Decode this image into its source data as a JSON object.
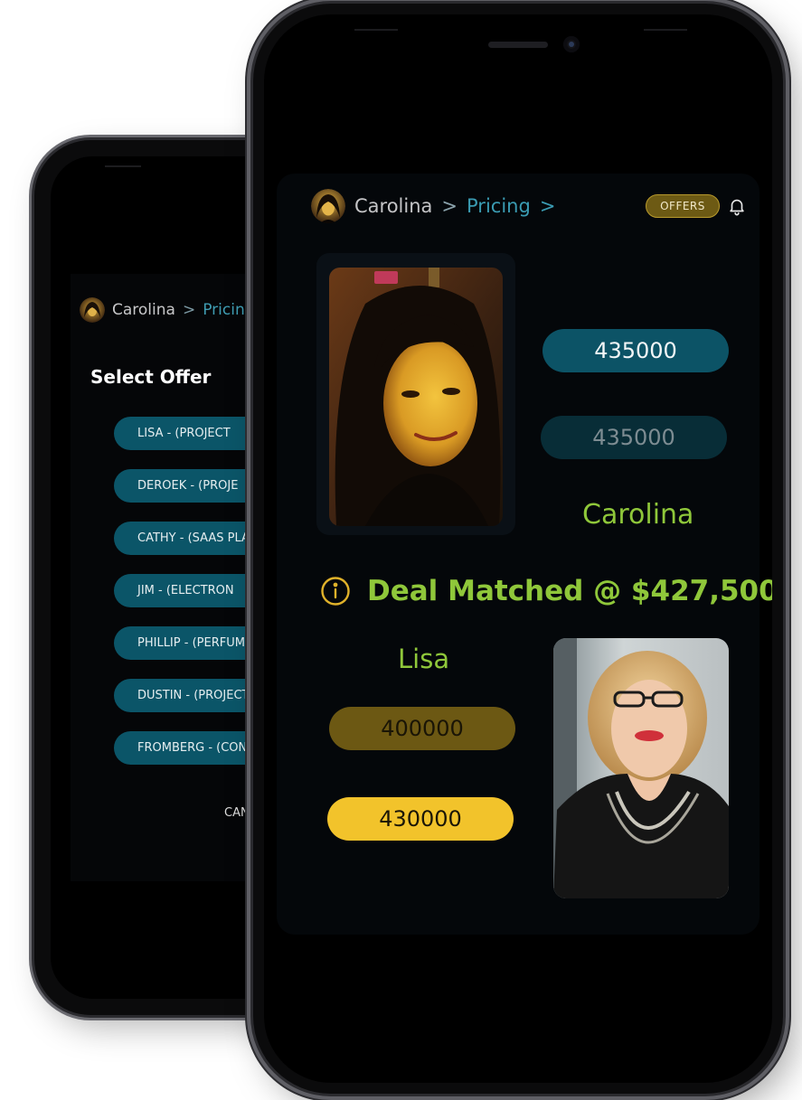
{
  "back_screen": {
    "breadcrumb": {
      "user": "Carolina",
      "page": "Pricing"
    },
    "title": "Select Offer",
    "offers": [
      "LISA - (PROJECT",
      "DEROEK - (PROJE",
      "CATHY - (SAAS PLAT",
      "JIM - (ELECTRON",
      "PHILLIP - (PERFUM",
      "DUSTIN - (PROJECT",
      "FROMBERG - (CON"
    ],
    "cancel_label": "CAN"
  },
  "front_screen": {
    "breadcrumb": {
      "user": "Carolina",
      "separator": ">",
      "page": "Pricing",
      "trailing": ">"
    },
    "offers_button": "OFFERS",
    "icons": {
      "bell": "bell-icon",
      "info": "info-icon"
    },
    "seller": {
      "name": "Carolina",
      "ask_primary": "435000",
      "ask_secondary": "435000"
    },
    "deal_text": "Deal Matched @ $427,500",
    "buyer": {
      "name": "Lisa",
      "bid_previous": "400000",
      "bid_current": "430000"
    }
  },
  "colors": {
    "accent_teal": "#0c5366",
    "accent_green": "#8fc73a",
    "accent_gold": "#f2c32b",
    "accent_dark_gold": "#6c5813"
  }
}
